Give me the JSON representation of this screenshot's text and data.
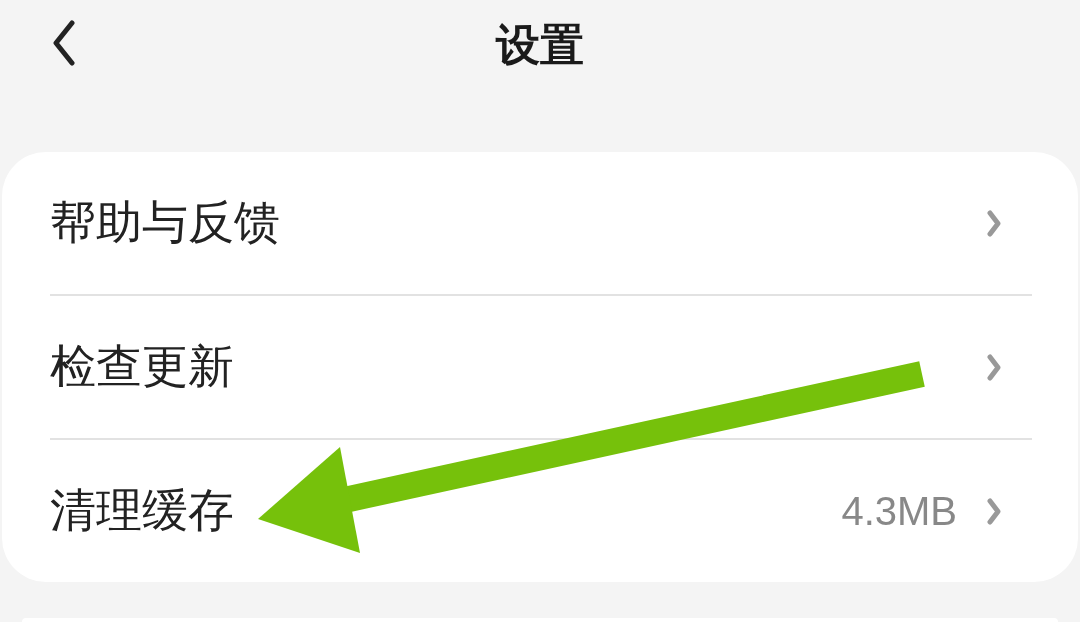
{
  "header": {
    "title": "设置"
  },
  "settings": [
    {
      "label": "帮助与反馈"
    },
    {
      "label": "检查更新"
    },
    {
      "label": "清理缓存",
      "value": "4.3MB"
    }
  ]
}
